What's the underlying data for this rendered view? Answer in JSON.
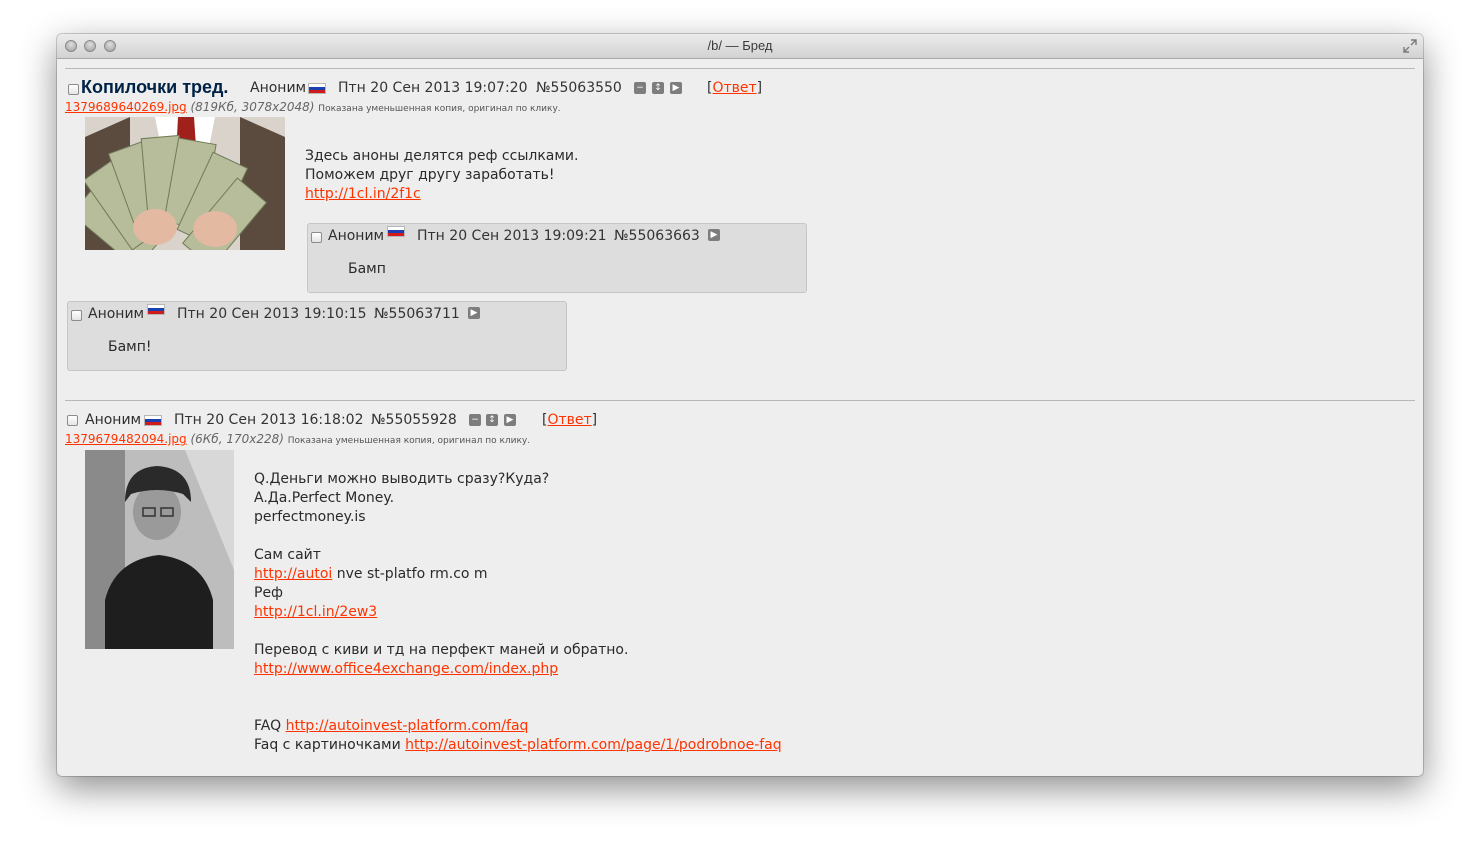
{
  "window": {
    "title": "/b/ — Бред"
  },
  "thread1": {
    "subject": "Копилочки тред.",
    "name": "Аноним",
    "datetime": "Птн 20 Сен 2013 19:07:20",
    "num": "№55063550",
    "reply_open": "[",
    "reply_label": "Ответ",
    "reply_close": "]",
    "file_name": "1379689640269.jpg",
    "file_info": "(819Кб, 3078x2048)",
    "file_note": "Показана уменьшенная копия, оригинал по клику.",
    "lines": [
      "Здесь аноны делятся реф ссылками.",
      "Поможем друг другу заработать!"
    ],
    "link": "http://1cl.in/2f1c"
  },
  "reply1": {
    "name": "Аноним",
    "datetime": "Птн 20 Сен 2013 19:09:21",
    "num": "№55063663",
    "text": "Бамп"
  },
  "reply2": {
    "name": "Аноним",
    "datetime": "Птн 20 Сен 2013 19:10:15",
    "num": "№55063711",
    "text": "Бамп!"
  },
  "thread2": {
    "name": "Аноним",
    "datetime": "Птн 20 Сен 2013 16:18:02",
    "num": "№55055928",
    "reply_open": "[",
    "reply_label": "Ответ",
    "reply_close": "]",
    "file_name": "1379679482094.jpg",
    "file_info": "(6Кб, 170x228)",
    "file_note": "Показана уменьшенная копия, оригинал по клику.",
    "line1": "Q.Деньги можно выводить сразу?Куда?",
    "line2": "A.Да.Perfect Money.",
    "line3": "perfectmoney.is",
    "line4": "Сам сайт",
    "link1": "http://autoi",
    "line5_rest": " nve st-platfo rm.co m",
    "line6": "Реф",
    "link2": "http://1cl.in/2ew3",
    "line7": "Перевод с киви и тд на перфект маней и обратно.",
    "link3": "http://www.office4exchange.com/index.php",
    "faq_label": "FAQ ",
    "faq_link": "http://autoinvest-platform.com/faq",
    "faq2_label": "Faq с картиночками ",
    "faq2_link": "http://autoinvest-platform.com/page/1/podrobnoe-faq"
  },
  "icons": {
    "hide": "minus-icon",
    "expand": "expand-icon",
    "play": "play-icon",
    "fullscreen": "fullscreen-icon"
  },
  "colors": {
    "link": "#ff3300",
    "subject": "#002244",
    "background": "#eeeeee",
    "reply_bg": "#dddddd"
  }
}
